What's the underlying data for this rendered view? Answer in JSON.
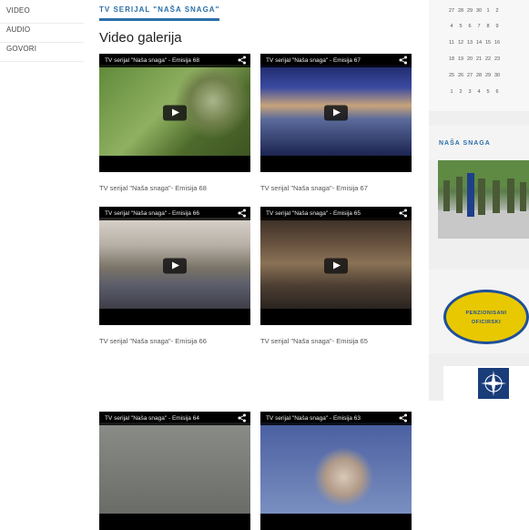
{
  "left_nav": {
    "items": [
      "VIDEO",
      "AUDIO",
      "GOVORI"
    ]
  },
  "main": {
    "section_label": "TV SERIJAL \"NAŠA SNAGA\"",
    "title": "Video galerija",
    "videos": [
      {
        "bar_title": "TV serijal \"Naša snaga\" - Emisija 68",
        "caption": "TV serijal \"Naša snaga\"- Emisija 68"
      },
      {
        "bar_title": "TV serijal \"Naša snaga\" - Emisija 67",
        "caption": "TV serijal \"Naša snaga\"- Emisija 67"
      },
      {
        "bar_title": "TV serijal \"Naša snaga\" - Emisija 66",
        "caption": "TV serijal \"Naša snaga\"- Emisija 66"
      },
      {
        "bar_title": "TV serijal \"Naša snaga\" - Emisija 65",
        "caption": "TV serijal \"Naša snaga\"- Emisija 65"
      },
      {
        "bar_title": "TV serijal \"Naša snaga\" - Emisija 64",
        "caption": ""
      },
      {
        "bar_title": "TV serijal \"Naša snaga\" - Emisija 63",
        "caption": ""
      }
    ]
  },
  "sidebar": {
    "calendar": {
      "rows": [
        [
          "27",
          "28",
          "29",
          "30",
          "1",
          "2"
        ],
        [
          "4",
          "5",
          "6",
          "7",
          "8",
          "9"
        ],
        [
          "11",
          "12",
          "13",
          "14",
          "15",
          "16"
        ],
        [
          "18",
          "19",
          "20",
          "21",
          "22",
          "23"
        ],
        [
          "25",
          "26",
          "27",
          "28",
          "29",
          "30"
        ],
        [
          "1",
          "2",
          "3",
          "4",
          "5",
          "6"
        ]
      ]
    },
    "nasa_snaga_label": "NAŠA SNAGA",
    "emblem": {
      "line1": "PENZIONISANI",
      "line2": "OFICIRSKI"
    }
  },
  "colors": {
    "accent": "#2b6ea8",
    "emblem_yellow": "#e8c800",
    "emblem_blue": "#1f4f9a"
  }
}
